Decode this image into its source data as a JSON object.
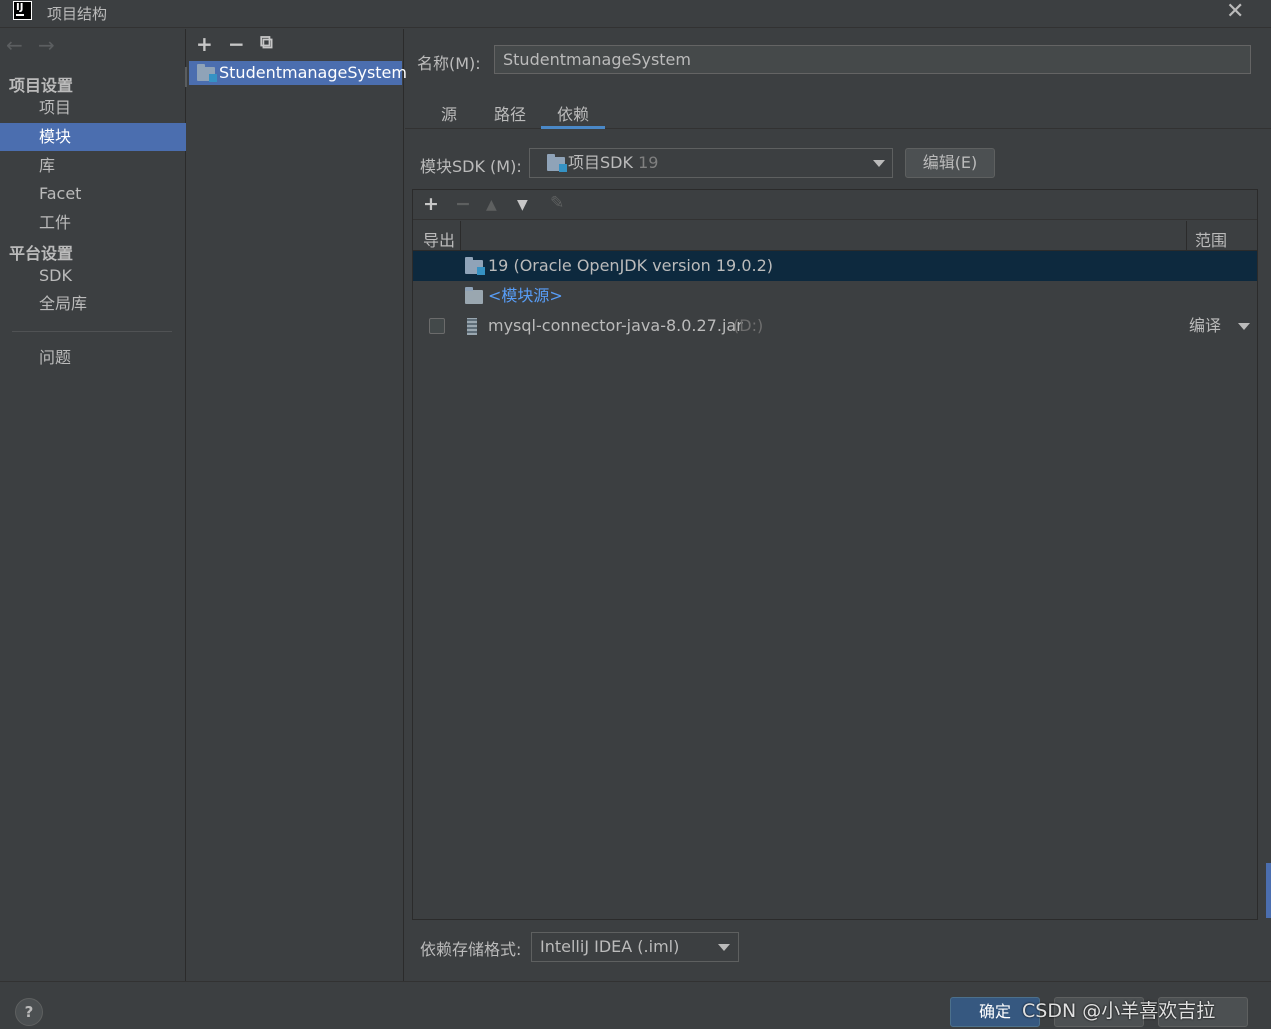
{
  "window": {
    "title": "项目结构",
    "close_label": "✕"
  },
  "nav": {
    "back_label": "←",
    "forward_label": "→",
    "section_project": "项目设置",
    "section_platform": "平台设置",
    "items": [
      {
        "label": "项目"
      },
      {
        "label": "模块"
      },
      {
        "label": "库"
      },
      {
        "label": "Facet"
      },
      {
        "label": "工件"
      },
      {
        "label": "SDK"
      },
      {
        "label": "全局库"
      },
      {
        "label": "问题"
      }
    ],
    "selected": "模块"
  },
  "modules": {
    "toolbar": {
      "add": "+",
      "remove": "−",
      "copy": "⧉"
    },
    "items": [
      {
        "label": "StudentmanageSystem"
      }
    ]
  },
  "module_settings": {
    "name_label": "名称(M):",
    "name_value": "StudentmanageSystem",
    "tabs": [
      {
        "label": "源"
      },
      {
        "label": "路径"
      },
      {
        "label": "依赖"
      }
    ],
    "active_tab": "依赖",
    "sdk_label": "模块SDK (M):",
    "sdk_value": "项目SDK",
    "sdk_version": "19",
    "edit_button": "编辑(E)",
    "dep_toolbar": {
      "add": "+",
      "remove": "−",
      "up": "▲",
      "down": "▼",
      "edit": "✎"
    },
    "columns": {
      "export": "导出",
      "scope": "范围"
    },
    "dependencies": [
      {
        "name": "19 (Oracle OpenJDK version 19.0.2)"
      },
      {
        "name": "<模块源>"
      },
      {
        "name": "mysql-connector-java-8.0.27.jar",
        "location": "(D:)",
        "scope": "编译"
      }
    ],
    "storage_label": "依赖存储格式:",
    "storage_value": "IntelliJ IDEA (.iml)"
  },
  "footer": {
    "help_label": "?",
    "ok_label": "确定",
    "watermark": "CSDN @小羊喜欢吉拉"
  },
  "colors": {
    "background": "#3c3f41",
    "selection": "#4b6eaf",
    "table_selection": "#0d293e",
    "link": "#589df6",
    "tab_underline": "#4a88c7"
  }
}
